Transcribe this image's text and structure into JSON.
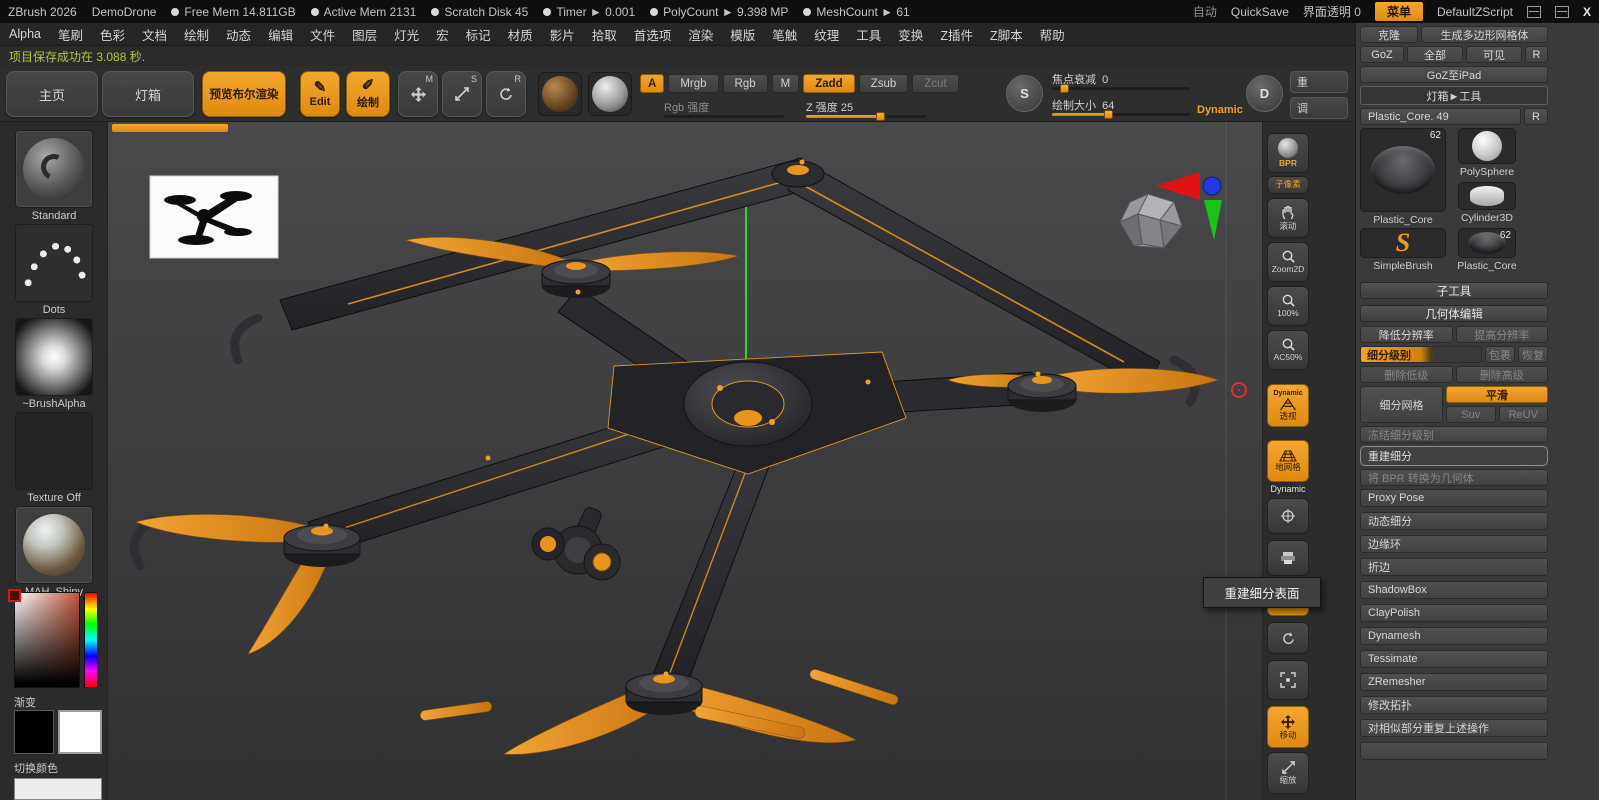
{
  "titlebar": {
    "app_title": "ZBrush 2026",
    "project_name": "DemoDrone",
    "stats": [
      "Free Mem 14.811GB",
      "Active Mem 2131",
      "Scratch Disk 45",
      "Timer ► 0.001",
      "PolyCount ► 9.398 MP",
      "MeshCount ► 61"
    ],
    "auto_label": "自动",
    "quicksave_label": "QuickSave",
    "ui_opacity_label": "界面透明 0",
    "menu_button_label": "菜单",
    "zscript_label": "DefaultZScript",
    "close_label": "X"
  },
  "menubar": {
    "items": [
      "Alpha",
      "笔刷",
      "色彩",
      "文档",
      "绘制",
      "动态",
      "编辑",
      "文件",
      "图层",
      "灯光",
      "宏",
      "标记",
      "材质",
      "影片",
      "拾取",
      "首选项",
      "渲染",
      "模版",
      "笔触",
      "纹理",
      "工具",
      "变换",
      "Z插件",
      "Z脚本",
      "帮助"
    ]
  },
  "statusbar": {
    "message": "项目保存成功在 3.088 秒."
  },
  "toolbar": {
    "home_label": "主页",
    "lightbox_label": "灯箱",
    "preview_boolean_label": "预览布尔渲染",
    "edit_label": "Edit",
    "draw_label": "绘制",
    "move_badge": "M",
    "scale_badge": "S",
    "rotate_badge": "R",
    "channel_a_label": "A",
    "mrgb_label": "Mrgb",
    "rgb_label": "Rgb",
    "m_label": "M",
    "zadd_label": "Zadd",
    "zsub_label": "Zsub",
    "zcut_label": "Zcut",
    "rgb_intensity_label": "Rgb 强度",
    "z_intensity_label": "Z 强度 25",
    "sculptris_badge": "S",
    "focal_shift_label": "焦点衰减",
    "focal_shift_value": "0",
    "draw_size_label": "绘制大小",
    "draw_size_value": "64",
    "dynamic_label": "Dynamic",
    "d_badge": "D",
    "clipped_top_label": "重",
    "clipped_bottom_label": "调"
  },
  "left_shelf": {
    "brush_label": "Standard",
    "stroke_label": "Dots",
    "alpha_label": "~BrushAlpha",
    "texture_label": "Texture Off",
    "material_label": "MAH_Shiny",
    "gradient_label": "渐变",
    "switch_color_label": "切换颜色"
  },
  "right_shelf": {
    "bpr_label": "BPR",
    "spix_label": "子像素",
    "scroll_label": "滚动",
    "zoom_label": "Zoom2D",
    "actual_label": "100%",
    "aahalf_label": "AC50%",
    "persp_tag": "Dynamic",
    "persp_label": "透视",
    "floor_label": "地网格",
    "floor_tag": "Dynamic",
    "move_label": "移动",
    "scale_label": "缩放"
  },
  "tooltip": {
    "text": "重建细分表面"
  },
  "tool_panel": {
    "clone_label": "克隆",
    "make_polymesh_label": "生成多边形网格体",
    "goz_label": "GoZ",
    "all_label": "全部",
    "visible_label": "可见",
    "r_label": "R",
    "goz_ipad_label": "GoZ至iPad",
    "lightbox_tool_label": "灯箱►工具",
    "active_tool_label": "Plastic_Core. 49",
    "tools": [
      {
        "label": "Plastic_Core",
        "badge": "62"
      },
      {
        "label": "PolySphere",
        "badge": ""
      },
      {
        "label": "Cylinder3D",
        "badge": ""
      },
      {
        "label": "SimpleBrush",
        "badge": ""
      },
      {
        "label": "Plastic_Core",
        "badge": "62"
      }
    ],
    "subtool_header": "子工具",
    "geometry_header": "几何体编辑",
    "lower_res_label": "降低分辨率",
    "higher_res_label": "提高分辨率",
    "sdiv_label": "细分级别",
    "cage_label": "包裹",
    "restore_label": "恢复",
    "del_lower_label": "删除低级",
    "del_higher_label": "删除高级",
    "divide_label": "细分网格",
    "smt_label": "平滑",
    "suv_label": "Suv",
    "reuv_label": "ReUV",
    "freeze_label": "冻结细分级别",
    "reconstruct_label": "重建细分",
    "convert_bpr_label": "将 BPR 转换为几何体",
    "section_rows": [
      "Proxy Pose",
      "动态细分",
      "边缘环",
      "折边",
      "ShadowBox",
      "ClayPolish",
      "Dynamesh",
      "Tessimate",
      "ZRemesher",
      "修改拓扑",
      "对相似部分重复上述操作"
    ]
  }
}
